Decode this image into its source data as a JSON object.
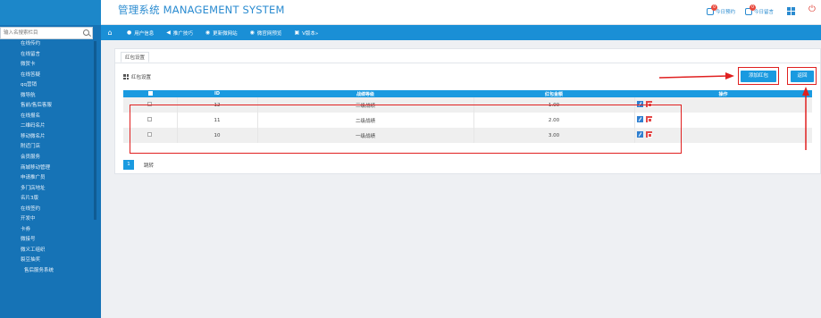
{
  "header": {
    "title": "管理系统 MANAGEMENT SYSTEM",
    "items": [
      {
        "label": "今日预约",
        "badge": "0",
        "icon": "user-icon"
      },
      {
        "label": "今日留言",
        "badge": "0",
        "icon": "message-icon"
      }
    ],
    "grid_icon": "grid-icon",
    "exit_icon": "exit-icon"
  },
  "sidebar": {
    "search_placeholder": "输入名搜索栏目",
    "items": [
      {
        "label": "在线传约"
      },
      {
        "label": "在线留言"
      },
      {
        "label": "微贺卡"
      },
      {
        "label": "在线答疑"
      },
      {
        "label": "qq营销"
      },
      {
        "label": "微导航"
      },
      {
        "label": "售前/售后客服"
      },
      {
        "label": "在线报名"
      },
      {
        "label": "二维码名片"
      },
      {
        "label": "移动微名片"
      },
      {
        "label": "附近门店"
      },
      {
        "label": "会员服务"
      },
      {
        "label": "商城移动管理"
      },
      {
        "label": "申请推广员"
      },
      {
        "label": "多门店地址"
      },
      {
        "label": "名片3版"
      },
      {
        "label": "在线签约"
      },
      {
        "label": "开发中"
      },
      {
        "label": "卡券"
      },
      {
        "label": "微接号"
      },
      {
        "label": "微义工组织"
      },
      {
        "label": "裂豆抽奖"
      },
      {
        "label": "售后服务系统",
        "sub": true
      }
    ]
  },
  "nav": {
    "home_icon": "home-icon",
    "items": [
      {
        "label": "用户信息",
        "icon": "user-icon"
      },
      {
        "label": "推广技巧",
        "icon": "megaphone-icon"
      },
      {
        "label": "更新微网站",
        "icon": "globe-icon"
      },
      {
        "label": "微官网预览",
        "icon": "eye-icon"
      },
      {
        "label": "V版本»",
        "icon": "version-icon"
      }
    ]
  },
  "content": {
    "tab_label": "红包设置",
    "section_title": "红包设置",
    "add_button": "添加红包",
    "back_button": "返回",
    "table": {
      "headers": [
        "",
        "ID",
        "战绩等级",
        "红包金额",
        "操作"
      ],
      "rows": [
        {
          "id": "12",
          "level": "三级战绩",
          "amount": "1.00"
        },
        {
          "id": "11",
          "level": "二级战绩",
          "amount": "2.00"
        },
        {
          "id": "10",
          "level": "一级战绩",
          "amount": "3.00"
        }
      ]
    },
    "pager": {
      "current": "1",
      "jump_label": "跳转"
    }
  },
  "colors": {
    "accent": "#1a9ae0",
    "sidebar": "#1673b6",
    "highlight": "#e02020"
  }
}
